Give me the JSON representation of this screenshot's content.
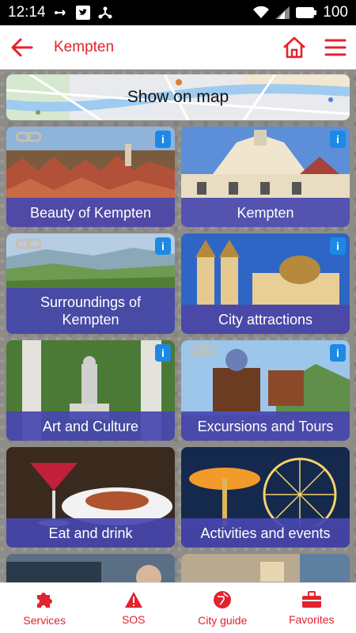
{
  "status": {
    "time": "12:14",
    "battery": "100"
  },
  "appbar": {
    "title": "Kempten"
  },
  "map": {
    "label": "Show on map"
  },
  "tiles": [
    {
      "label": "Beauty of Kempten",
      "info": "i"
    },
    {
      "label": "Kempten",
      "info": "i"
    },
    {
      "label": "Surroundings of Kempten",
      "info": "i"
    },
    {
      "label": "City attractions",
      "info": "i"
    },
    {
      "label": "Art and Culture",
      "info": "i"
    },
    {
      "label": "Excursions and Tours",
      "info": "i"
    },
    {
      "label": "Eat and drink"
    },
    {
      "label": "Activities and events"
    }
  ],
  "nav": {
    "services": "Services",
    "sos": "SOS",
    "cityguide": "City guide",
    "favorites": "Favorites"
  },
  "colors": {
    "accent": "#e1232d",
    "caption": "#4646af",
    "info": "#1e88e5"
  }
}
